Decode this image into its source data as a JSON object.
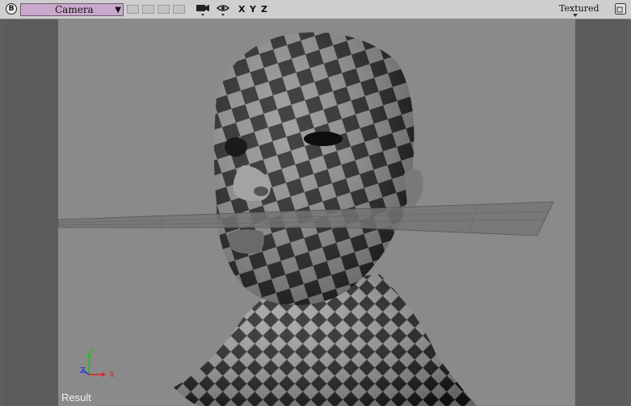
{
  "toolbar": {
    "corner_button_label": "B",
    "camera_selector": "Camera",
    "axis_labels": [
      "X",
      "Y",
      "Z"
    ],
    "shading_mode": "Textured"
  },
  "viewport": {
    "mode_label": "Result",
    "gizmo": {
      "x": "X",
      "y": "Y",
      "z": "Z"
    }
  },
  "colors": {
    "toolbar_bg": "#cfcfcf",
    "camera_selector_bg": "#c9a9cb",
    "viewport_bg": "#8a8a8a",
    "axis_x": "#e02020",
    "axis_y": "#20c020",
    "axis_z": "#2030e0"
  }
}
